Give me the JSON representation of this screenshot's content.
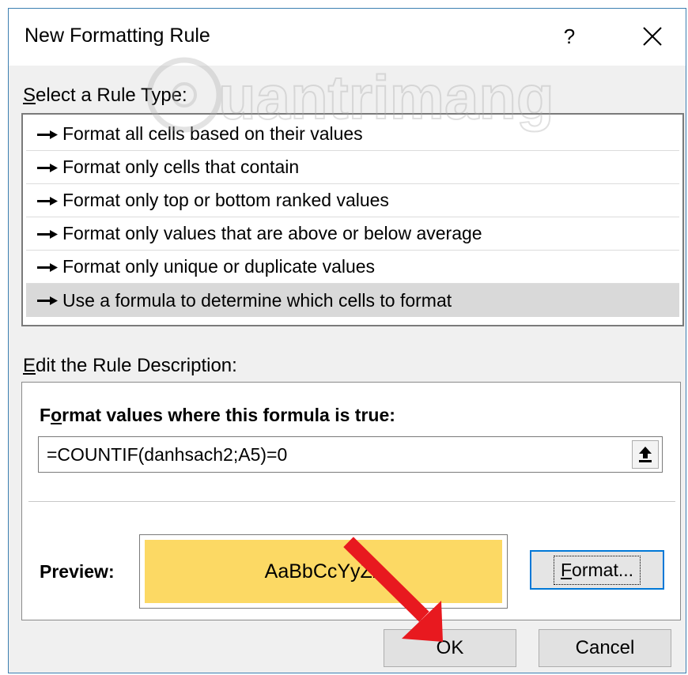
{
  "window": {
    "title": "New Formatting Rule",
    "help_label": "?"
  },
  "rule_type": {
    "label_accel": "S",
    "label_rest": "elect a Rule Type:",
    "items": [
      {
        "label": "Format all cells based on their values"
      },
      {
        "label": "Format only cells that contain"
      },
      {
        "label": "Format only top or bottom ranked values"
      },
      {
        "label": "Format only values that are above or below average"
      },
      {
        "label": "Format only unique or duplicate values"
      },
      {
        "label": "Use a formula to determine which cells to format"
      }
    ],
    "selected_label": "Use a formula to determine which cells to format"
  },
  "description": {
    "label_accel": "E",
    "label_rest": "dit the Rule Description:",
    "formula_label_pre": "F",
    "formula_label_accel": "o",
    "formula_label_rest": "rmat values where this formula is true:",
    "formula_value": "=COUNTIF(danhsach2;A5)=0",
    "preview_label": "Preview:",
    "preview_text": "AaBbCcYyZz",
    "preview_color": "#fcd964",
    "format_button_accel": "F",
    "format_button_rest": "ormat..."
  },
  "buttons": {
    "ok": "OK",
    "cancel": "Cancel"
  },
  "watermark": {
    "text": "uantrimang"
  },
  "colors": {
    "accent": "#0078d7",
    "annotation_arrow": "#e8191f",
    "selection_bg": "#d9d9d9"
  }
}
